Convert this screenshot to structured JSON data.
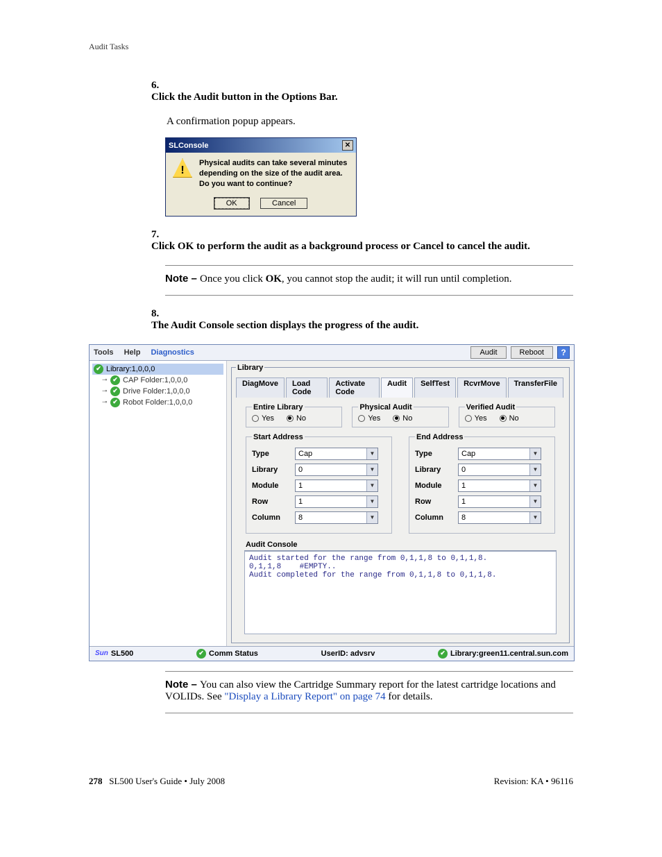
{
  "header_small": "Audit Tasks",
  "step6": {
    "num": "6.",
    "text": "Click the Audit button in the Options Bar."
  },
  "follow6": "A confirmation popup appears.",
  "dialog1": {
    "title": "SLConsole",
    "line1": "Physical audits can take several minutes",
    "line2": "depending on the size of the audit area.",
    "line3": "Do you want to continue?",
    "ok": "OK",
    "cancel": "Cancel"
  },
  "step7": {
    "num": "7.",
    "text": "Click OK to perform the audit as a background process or Cancel to cancel the audit."
  },
  "note7": {
    "label": "Note – ",
    "before": "Once you click ",
    "bold": "OK",
    "after": ", you cannot stop the audit; it will run until completion."
  },
  "step8": {
    "num": "8.",
    "text": "The Audit Console section displays the progress of the audit."
  },
  "app": {
    "menus": {
      "tools": "Tools",
      "help": "Help",
      "diag": "Diagnostics"
    },
    "rbtns": {
      "audit": "Audit",
      "reboot": "Reboot",
      "help": "?"
    },
    "tree": {
      "lib": "Library:1,0,0,0",
      "cap": "CAP Folder:1,0,0,0",
      "drive": "Drive Folder:1,0,0,0",
      "robot": "Robot Folder:1,0,0,0"
    },
    "mainLegend": "Library",
    "tabs": {
      "diagmove": "DiagMove",
      "loadcode": "Load Code",
      "activate": "Activate Code",
      "audit": "Audit",
      "selftest": "SelfTest",
      "rcvr": "RcvrMove",
      "transfer": "TransferFile"
    },
    "radios": {
      "entire": "Entire Library",
      "physical": "Physical Audit",
      "verified": "Verified Audit",
      "yes": "Yes",
      "no": "No"
    },
    "addr": {
      "start": "Start Address",
      "end": "End Address",
      "type": "Type",
      "library": "Library",
      "module": "Module",
      "row": "Row",
      "column": "Column"
    },
    "vals": {
      "start": {
        "type": "Cap",
        "library": "0",
        "module": "1",
        "row": "1",
        "column": "8"
      },
      "end": {
        "type": "Cap",
        "library": "0",
        "module": "1",
        "row": "1",
        "column": "8"
      }
    },
    "ac": {
      "title": "Audit Console",
      "l1": "Audit started for the range from 0,1,1,8 to 0,1,1,8.",
      "l2": "0,1,1,8    #EMPTY..",
      "l3": "Audit completed for the range from 0,1,1,8 to 0,1,1,8."
    },
    "status": {
      "sun": "Sun",
      "model": "SL500",
      "comm": "Comm Status",
      "user": "UserID: advsrv",
      "lib": "Library:green11.central.sun.com"
    }
  },
  "note_final": {
    "label": "Note – ",
    "t1": "You can also view the Cartridge Summary report for the latest cartridge locations and VOLIDs. See ",
    "link": "\"Display a Library Report\" on page 74",
    "t2": " for details."
  },
  "footer": {
    "pnum": "278",
    "left": "SL500 User's Guide • July 2008",
    "right": "Revision: KA • 96116"
  }
}
